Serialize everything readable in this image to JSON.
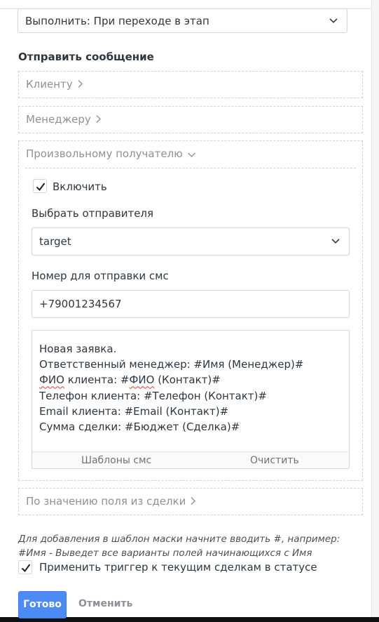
{
  "execute_select": {
    "value": "Выполнить: При переходе в этап"
  },
  "send_message": {
    "title": "Отправить сообщение",
    "sections": {
      "client": "Клиенту",
      "manager": "Менеджеру",
      "custom": "Произвольному получателю",
      "by_field": "По значению поля из сделки"
    },
    "custom": {
      "enable_label": "Включить",
      "enable_checked": true,
      "sender_label": "Выбрать отправителя",
      "sender_value": "target",
      "phone_label": "Номер для отправки смс",
      "phone_value": "+79001234567",
      "message_lines": [
        "Новая заявка.",
        "Ответственный менеджер: #Имя (Менеджер)#",
        "ФИО клиента: #ФИО (Контакт)#",
        "Телефон клиента: #Телефон (Контакт)#",
        "Email клиента: #Email (Контакт)#",
        "Сумма сделки: #Бюджет (Сделка)#"
      ],
      "templates_button": "Шаблоны смс",
      "clear_button": "Очистить"
    }
  },
  "hint_text": "Для добавления в шаблон маски начните вводить #, например: #Имя - Выведет все варианты полей начинающихся с Имя",
  "apply_trigger": {
    "label": "Применить триггер к текущим сделкам в статусе",
    "checked": true
  },
  "footer": {
    "done": "Готово",
    "cancel": "Отменить"
  },
  "colors": {
    "primary": "#4c8bf5",
    "muted_text": "#8e9197",
    "border": "#d4d5d8"
  },
  "icons": [
    "chevron-down-icon",
    "chevron-right-icon",
    "checkmark-icon"
  ]
}
